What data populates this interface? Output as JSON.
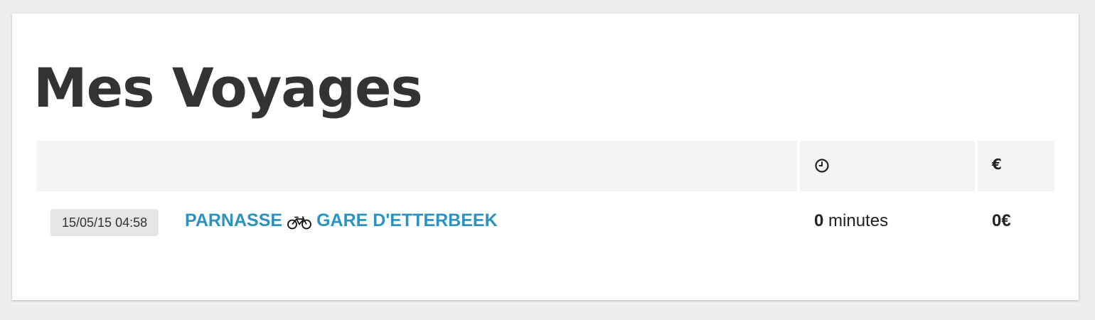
{
  "page": {
    "title": "Mes Voyages"
  },
  "table": {
    "headers": {
      "trip": "",
      "time_icon": "clock-icon",
      "price": "€"
    },
    "rows": [
      {
        "date": "15/05/15 04:58",
        "from": "PARNASSE",
        "mode_icon": "bike-icon",
        "to": "GARE D'ETTERBEEK",
        "duration_value": "0",
        "duration_unit": "minutes",
        "price": "0€"
      }
    ]
  },
  "colors": {
    "link": "#2a93c0",
    "title": "#333333",
    "header_bg": "#f4f4f4",
    "badge_bg": "#e5e5e5",
    "page_bg": "#eeeeee"
  }
}
